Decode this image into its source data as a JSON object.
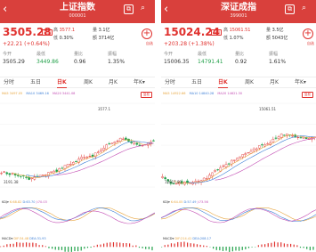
{
  "panels": [
    {
      "title": "上证指数",
      "code": "000001",
      "price": "3505.28",
      "tag": "可用",
      "change": "+22.21  (+0.64%)",
      "stats": {
        "high_label": "高",
        "high": "3577.1",
        "volume_label": "量",
        "volume": "3.1亿",
        "amount_label": "额",
        "amount": "3714亿",
        "turnover_label": "换",
        "turnover": "0.30%",
        "low_label": "低",
        "low": "3449.8"
      },
      "row2": [
        "今开",
        "最低",
        "量比",
        "振幅"
      ],
      "row3": [
        "3505.29",
        "3449.86",
        "0.96",
        "1.35%"
      ],
      "plus_label": "自选",
      "tabs": [
        "分时",
        "五日",
        "日K",
        "周K",
        "月K",
        "年K▾"
      ],
      "ma_line": [
        "MA5 3497.05",
        "MA10 3469.16",
        "MA20 3441.08",
        "MA30 3384.61"
      ],
      "chart_button": "复权",
      "high_mark": "3577.1",
      "low_mark": "3191.38",
      "ind1_line": [
        "KDJ▾",
        "K:68.82",
        "D:63.70",
        "J:70.03"
      ],
      "ind2_line": [
        "MACD▾",
        "DIF:34.48",
        "DEA:31.93",
        "MACD:5.10"
      ]
    },
    {
      "title": "深证成指",
      "code": "399001",
      "price": "15024.24",
      "tag": "可用",
      "change": "+203.28  (+1.38%)",
      "stats": {
        "high_label": "高",
        "high": "15061.51",
        "volume_label": "量",
        "volume": "3.5亿",
        "amount_label": "额",
        "amount": "5043亿",
        "turnover_label": "换",
        "turnover": "1.07%",
        "low_label": "低",
        "low": "14791.41"
      },
      "row2": [
        "今开",
        "最低",
        "量比",
        "振幅"
      ],
      "row3": [
        "15006.35",
        "14791.41",
        "0.92",
        "1.61%"
      ],
      "plus_label": "自选",
      "tabs": [
        "分时",
        "五日",
        "日K",
        "周K",
        "月K",
        "年K▾"
      ],
      "ma_line": [
        "MA5 14922.66",
        "MA10 14840.28",
        "MA20 14621.30",
        "MA30 14226.77"
      ],
      "chart_button": "复权",
      "high_mark": "15061.51",
      "low_mark": "12917.80",
      "ind1_line": [
        "KDJ▾",
        "K:64.05",
        "D:57.49",
        "J:73.56"
      ],
      "ind2_line": [
        "MACD▾",
        "DIF:214.41",
        "DEA:208.17",
        "MACD:12.48"
      ]
    }
  ],
  "colors": {
    "header": "#d9403c",
    "up": "#e0312e",
    "down": "#22a14a",
    "ma5": "#e7a43c",
    "ma10": "#3d7fd6",
    "ma20": "#c24cb3",
    "ma30": "#2fa46d"
  },
  "icons": [
    "back-arrow-icon",
    "compare-icon",
    "search-icon",
    "add-icon"
  ]
}
